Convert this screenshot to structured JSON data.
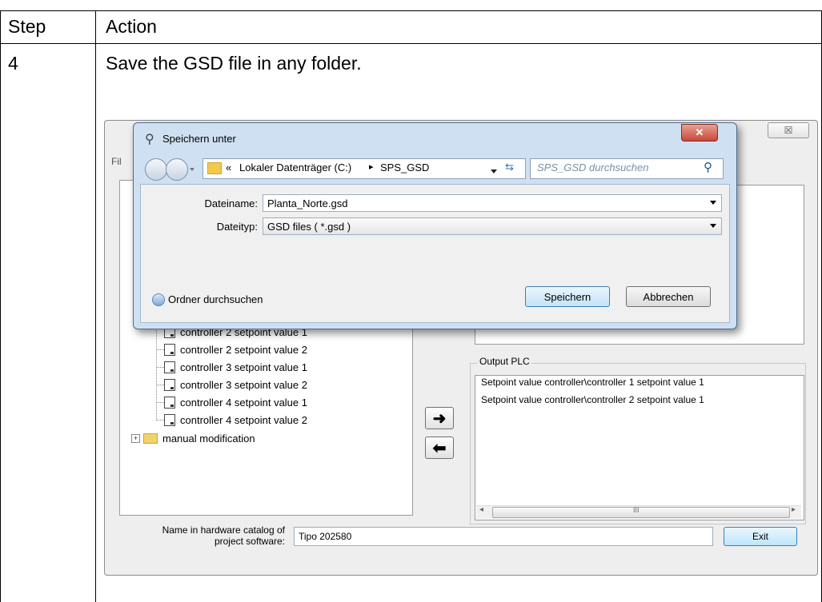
{
  "table": {
    "header_step": "Step",
    "header_action": "Action",
    "row_step": "4",
    "row_action": "Save the GSD file in any folder."
  },
  "app": {
    "menu_first": "Fil",
    "tree_items": [
      "controller 2 setpoint value 1",
      "controller 2 setpoint value 2",
      "controller 3 setpoint value 1",
      "controller 3 setpoint value 2",
      "controller 4 setpoint value 1",
      "controller 4 setpoint value 2"
    ],
    "tree_folder": "manual modification",
    "output_label": "Output PLC",
    "output_items": [
      "Setpoint value controller\\controller 1 setpoint value 1",
      "Setpoint value controller\\controller 2 setpoint value 1"
    ],
    "scroll_mid": "III",
    "catalog_label_1": "Name in hardware catalog of",
    "catalog_label_2": "project software:",
    "catalog_value": "Tipo 202580",
    "exit_label": "Exit",
    "arrow_right": "➜",
    "arrow_left": "⬅",
    "close_glyph": "☒"
  },
  "dialog": {
    "title": "Speichern unter",
    "close_glyph": "✕",
    "path_prefix": "«",
    "path_drive": "Lokaler Datenträger (C:)",
    "path_sep": "▸",
    "path_folder": "SPS_GSD",
    "search_placeholder": "SPS_GSD durchsuchen",
    "filename_label": "Dateiname:",
    "filename_value": "Planta_Norte.gsd",
    "filetype_label": "Dateityp:",
    "filetype_value": "GSD files ( *.gsd )",
    "browse_label": "Ordner durchsuchen",
    "save_label": "Speichern",
    "cancel_label": "Abbrechen"
  }
}
